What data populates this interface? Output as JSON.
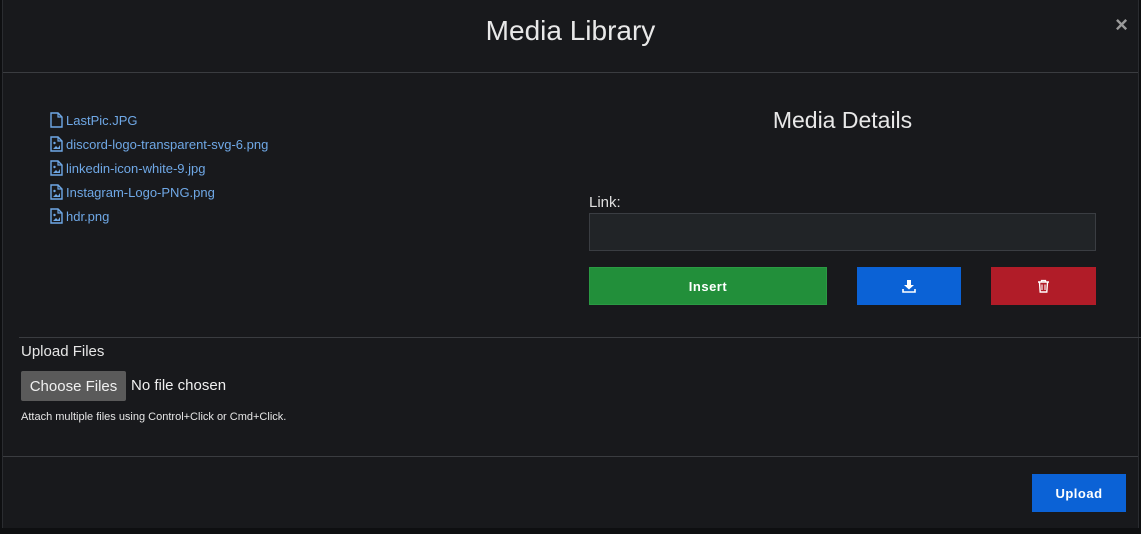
{
  "modal": {
    "title": "Media Library",
    "close_symbol": "×"
  },
  "files": [
    {
      "name": "LastPic.JPG",
      "icon": "file-icon"
    },
    {
      "name": "discord-logo-transparent-svg-6.png",
      "icon": "file-image-icon"
    },
    {
      "name": "linkedin-icon-white-9.jpg",
      "icon": "file-image-icon"
    },
    {
      "name": "Instagram-Logo-PNG.png",
      "icon": "file-image-icon"
    },
    {
      "name": "hdr.png",
      "icon": "file-image-icon"
    }
  ],
  "details": {
    "title": "Media Details",
    "link_label": "Link:",
    "link_value": "",
    "insert_label": "Insert",
    "download_icon": "download-icon",
    "delete_icon": "trash-icon"
  },
  "upload": {
    "label": "Upload Files",
    "choose_label": "Choose Files",
    "no_file_text": "No file chosen",
    "hint": "Attach multiple files using Control+Click or Cmd+Click.",
    "upload_button": "Upload"
  },
  "colors": {
    "link": "#6fa8e6",
    "insert": "#228f3a",
    "primary": "#0b62d6",
    "danger": "#b11c28",
    "background": "#18191c"
  }
}
